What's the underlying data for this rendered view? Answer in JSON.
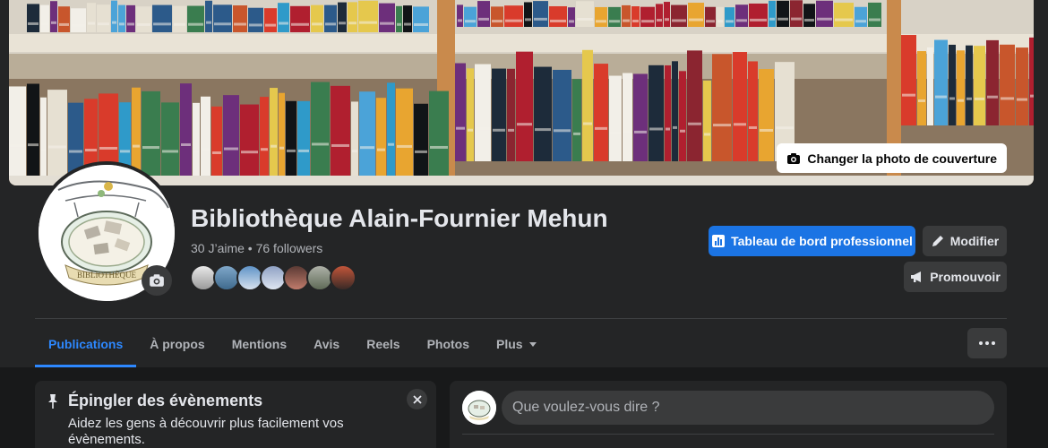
{
  "cover": {
    "change_button_label": "Changer la photo de couverture",
    "change_button_icon": "camera-icon"
  },
  "page": {
    "name": "Bibliothèque Alain-Fournier Mehun",
    "stats": "30 J’aime • 76 followers",
    "follower_avatar_count": 7
  },
  "actions": {
    "dashboard_label": "Tableau de bord professionnel",
    "dashboard_icon": "bar-chart-icon",
    "edit_label": "Modifier",
    "edit_icon": "pencil-icon",
    "promote_label": "Promouvoir",
    "promote_icon": "megaphone-icon"
  },
  "tabs": [
    {
      "label": "Publications",
      "active": true
    },
    {
      "label": "À propos",
      "active": false
    },
    {
      "label": "Mentions",
      "active": false
    },
    {
      "label": "Avis",
      "active": false
    },
    {
      "label": "Reels",
      "active": false
    },
    {
      "label": "Photos",
      "active": false
    },
    {
      "label": "Plus",
      "active": false
    }
  ],
  "pin_events": {
    "title": "Épingler des évènements",
    "description": "Aidez les gens à découvrir plus facilement vos évènements.",
    "icon": "pin-icon",
    "close_icon": "close-icon"
  },
  "composer": {
    "placeholder": "Que voulez-vous dire ?"
  },
  "colors": {
    "background": "#18191a",
    "card": "#242526",
    "accent": "#2d88ff",
    "primary_button": "#1b74e4",
    "secondary_button": "#3a3b3c"
  }
}
